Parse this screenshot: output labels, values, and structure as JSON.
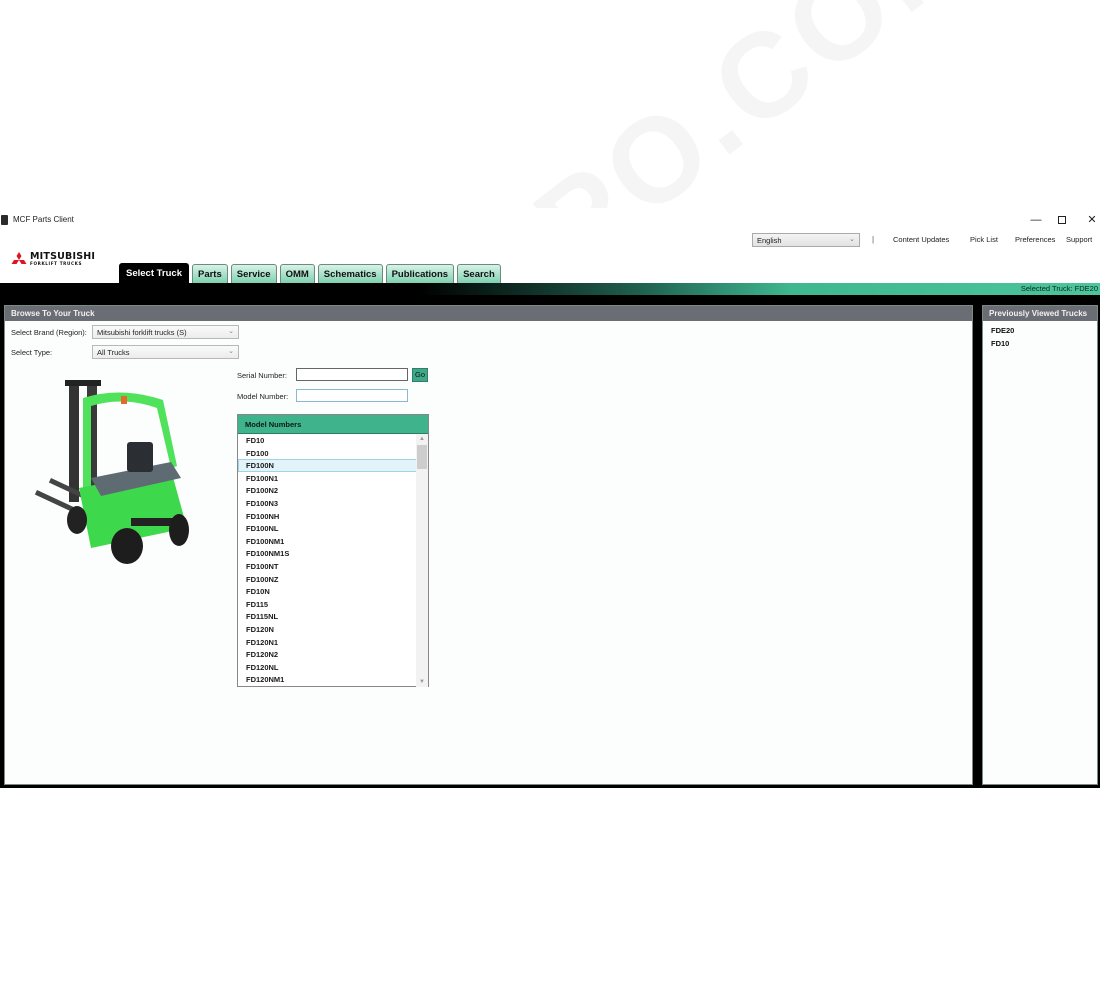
{
  "window": {
    "title": "MCF Parts Client",
    "controls": {
      "minimize": "—",
      "maximize": "☐",
      "close": "✕"
    }
  },
  "header": {
    "language": {
      "selected": "English"
    },
    "separator": "|",
    "links": [
      "Content Updates",
      "Pick List",
      "Preferences",
      "Support"
    ],
    "logo": {
      "brand": "MITSUBISHI",
      "subtitle": "FORKLIFT TRUCKS"
    }
  },
  "tabs": [
    {
      "label": "Select Truck",
      "active": true
    },
    {
      "label": "Parts",
      "active": false
    },
    {
      "label": "Service",
      "active": false
    },
    {
      "label": "OMM",
      "active": false
    },
    {
      "label": "Schematics",
      "active": false
    },
    {
      "label": "Publications",
      "active": false
    },
    {
      "label": "Search",
      "active": false
    }
  ],
  "status": {
    "selected_truck": "Selected Truck:  FDE20"
  },
  "browse": {
    "title": "Browse To Your Truck",
    "brand_label": "Select Brand (Region):",
    "brand_value": "Mitsubishi forklift trucks (S)",
    "type_label": "Select Type:",
    "type_value": "All Trucks",
    "serial_label": "Serial Number:",
    "serial_value": "",
    "go_label": "Go",
    "model_label": "Model Number:",
    "model_value": "",
    "model_list": {
      "header": "Model Numbers",
      "selected": "FD100N",
      "items": [
        "FD10",
        "FD100",
        "FD100N",
        "FD100N1",
        "FD100N2",
        "FD100N3",
        "FD100NH",
        "FD100NL",
        "FD100NM1",
        "FD100NM1S",
        "FD100NT",
        "FD100NZ",
        "FD10N",
        "FD115",
        "FD115NL",
        "FD120N",
        "FD120N1",
        "FD120N2",
        "FD120NL",
        "FD120NM1"
      ]
    }
  },
  "previously_viewed": {
    "title": "Previously Viewed Trucks",
    "items": [
      "FDE20",
      "FD10"
    ]
  },
  "watermark": "EPCDEPO.COM",
  "colors": {
    "accent_green": "#3fb48c",
    "panel_header": "#6b6d74",
    "tab_active": "#000000"
  }
}
